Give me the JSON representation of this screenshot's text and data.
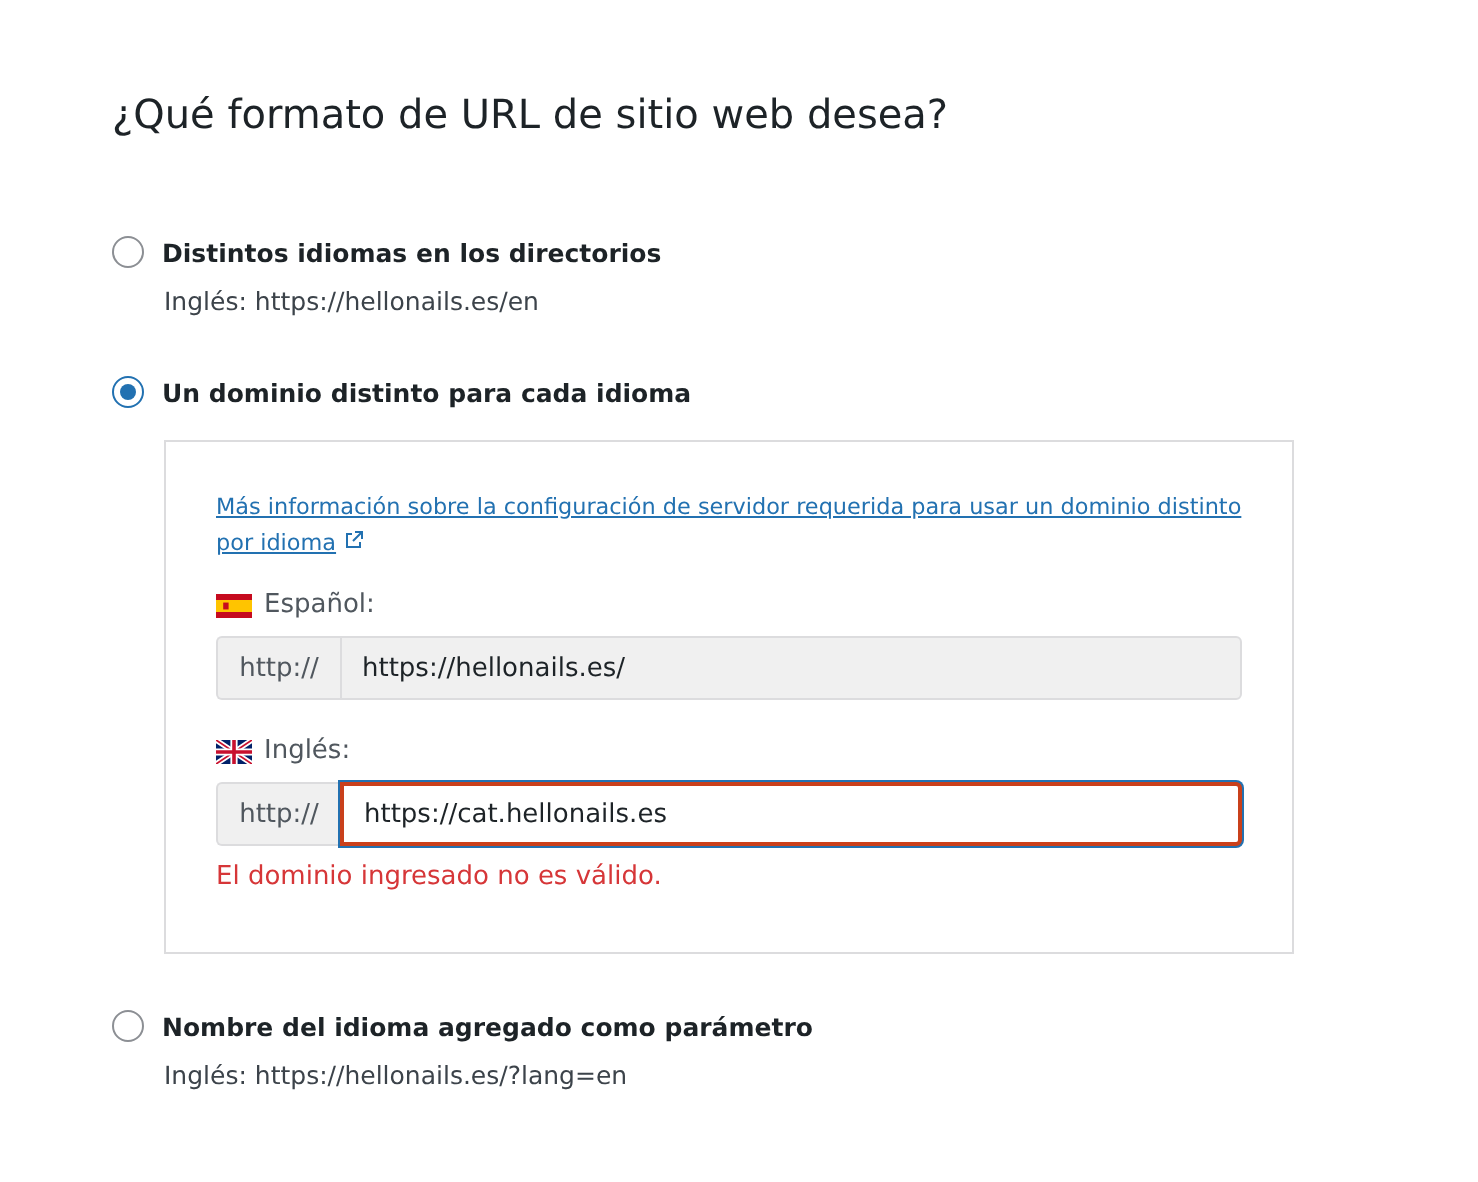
{
  "title": "¿Qué formato de URL de sitio web desea?",
  "options": [
    {
      "label": "Distintos idiomas en los directorios",
      "selected": false,
      "example": "Inglés: https://hellonails.es/en"
    },
    {
      "label": "Un dominio distinto para cada idioma",
      "selected": true,
      "panel": {
        "link": "Más información sobre la configuración de servidor requerida para usar un dominio distinto por idioma",
        "languages": [
          {
            "kind": "es",
            "label": "Español:",
            "prefix": "http://",
            "value": "https://hellonails.es/",
            "disabled": true,
            "invalid": false
          },
          {
            "kind": "gb",
            "label": "Inglés:",
            "prefix": "http://",
            "value": "https://cat.hellonails.es",
            "disabled": false,
            "invalid": true,
            "error": "El dominio ingresado no es válido."
          }
        ]
      }
    },
    {
      "label": "Nombre del idioma agregado como parámetro",
      "selected": false,
      "example": "Inglés: https://hellonails.es/?lang=en"
    }
  ]
}
